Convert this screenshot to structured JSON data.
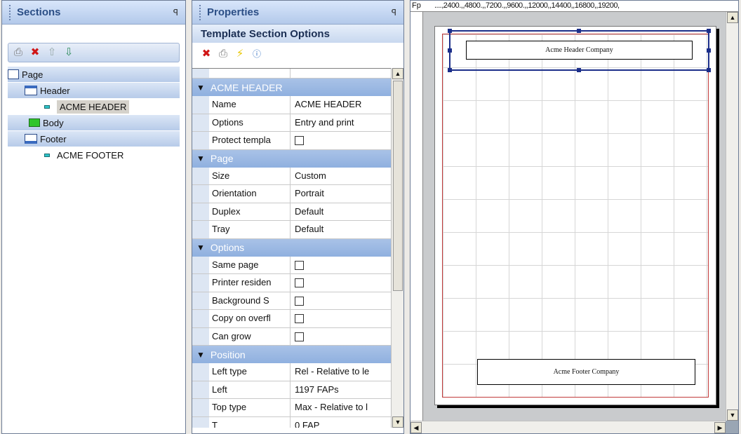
{
  "sections_panel": {
    "title": "Sections",
    "pin": "ꟼ",
    "toolbar": [
      "print-icon",
      "delete-icon",
      "move-up-icon",
      "move-down-icon"
    ],
    "tree": [
      {
        "label": "Page",
        "level": 0,
        "group": true
      },
      {
        "label": "Header",
        "level": 1,
        "group": true
      },
      {
        "label": "ACME HEADER",
        "level": 2,
        "group": false,
        "selected": true
      },
      {
        "label": "Body",
        "level": 1,
        "group": true
      },
      {
        "label": "Footer",
        "level": 1,
        "group": true
      },
      {
        "label": "ACME FOOTER",
        "level": 2,
        "group": false
      }
    ]
  },
  "properties_panel": {
    "title": "Properties",
    "pin": "ꟼ",
    "subtitle": "Template Section Options",
    "toolbar": [
      "delete-icon",
      "print-icon",
      "lightning-icon",
      "info-icon"
    ],
    "groups": [
      {
        "name": "ACME HEADER",
        "rows": [
          {
            "name": "Name",
            "value": "ACME HEADER"
          },
          {
            "name": "Options",
            "value": "Entry and print"
          },
          {
            "name": "Protect templa",
            "checkbox": true
          }
        ]
      },
      {
        "name": "Page",
        "rows": [
          {
            "name": "Size",
            "value": "Custom"
          },
          {
            "name": "Orientation",
            "value": "Portrait"
          },
          {
            "name": "Duplex",
            "value": "Default"
          },
          {
            "name": "Tray",
            "value": "Default"
          }
        ]
      },
      {
        "name": "Options",
        "rows": [
          {
            "name": "Same page",
            "checkbox": true
          },
          {
            "name": "Printer residen",
            "checkbox": true
          },
          {
            "name": "Background S",
            "checkbox": true
          },
          {
            "name": "Copy on overfl",
            "checkbox": true
          },
          {
            "name": "Can grow",
            "checkbox": true
          }
        ]
      },
      {
        "name": "Position",
        "rows": [
          {
            "name": "Left type",
            "value": "Rel - Relative to le"
          },
          {
            "name": "Left",
            "value": "1197 FAPs"
          },
          {
            "name": "Top type",
            "value": "Max - Relative to l"
          },
          {
            "name": "T",
            "value": "0 FAP"
          }
        ]
      }
    ]
  },
  "designer": {
    "ruler_prefix": "Fp",
    "ruler_marks": "....,2400.,,4800.,,7200.,,9600.,,12000,,14400,,16800,,19200,",
    "left_ruler_marks": "-",
    "header_text": "Acme Header Company",
    "footer_text": "Acme Footer Company"
  }
}
